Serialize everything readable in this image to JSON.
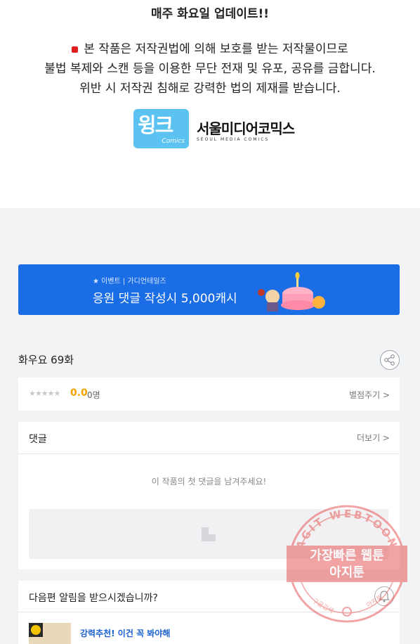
{
  "notice": {
    "title": "매주 화요일 업데이트!!",
    "line1": "본 작품은 저작권법에 의해 보호를 받는 저작물이므로",
    "line2": "불법 복제와 스캔 등을 이용한 무단 전재 및 유포, 공유를 금합니다.",
    "line3": "위반 시 저작권 침해로 강력한 법의 제재를 받습니다."
  },
  "logos": {
    "wink_main": "윙크",
    "wink_sub": "Comics",
    "seoul_kr": "서울미디어코믹스",
    "seoul_en": "SEOUL MEDIA COMICS"
  },
  "banner": {
    "tag": "★ 이벤트 | 가디언테일즈",
    "headline": "응원 댓글 작성시 5,000캐시",
    "color": "#1a6de4"
  },
  "episode": {
    "title": "화우요 69화"
  },
  "rating": {
    "stars": "★★★★★",
    "score": "0.0",
    "count": "0명",
    "rate_label": "별점주기 >"
  },
  "comments": {
    "header": "댓글",
    "more_label": "더보기 >",
    "empty_message": "이 작품의 첫 댓글을 남겨주세요!"
  },
  "next_episode": {
    "question": "다음편 알림을 받으시겠습니까?",
    "promo_text": "강력추천! 이건 꼭 봐야해"
  },
  "watermark": {
    "arc_text": "AGIT WEBTOON",
    "line1": "가장빠른 웹툰",
    "line2": "아지툰",
    "bottom_left": "구글검색",
    "bottom_right": "아지툰",
    "color": "#e85a5a"
  }
}
